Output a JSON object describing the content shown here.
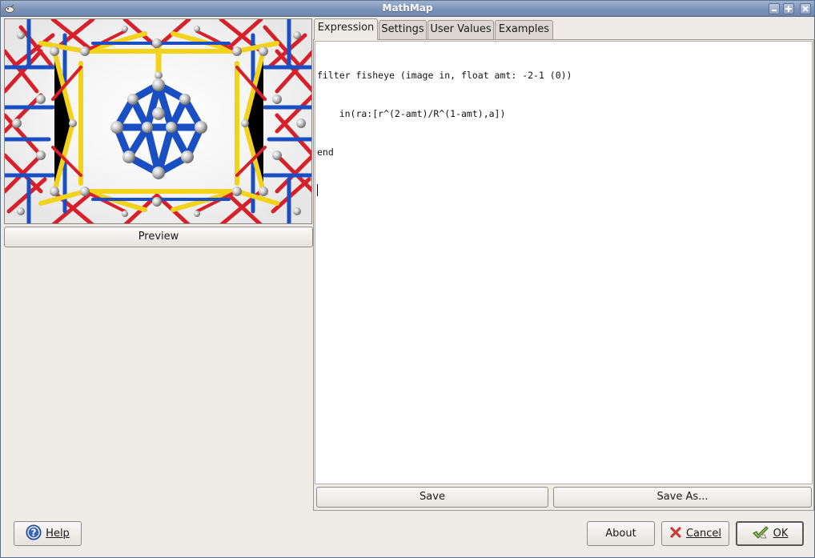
{
  "window": {
    "title": "MathMap"
  },
  "left": {
    "preview_button": "Preview"
  },
  "tabs": [
    {
      "label": "Expression",
      "active": true
    },
    {
      "label": "Settings",
      "active": false
    },
    {
      "label": "User Values",
      "active": false
    },
    {
      "label": "Examples",
      "active": false
    }
  ],
  "editor": {
    "lines": [
      "filter fisheye (image in, float amt: -2-1 (0))",
      "    in(ra:[r^(2-amt)/R^(1-amt),a])",
      "end"
    ]
  },
  "editor_buttons": {
    "save": "Save",
    "save_as": "Save As..."
  },
  "footer": {
    "help": "Help",
    "about": "About",
    "cancel": "Cancel",
    "ok": "OK"
  },
  "colors": {
    "titlebar": "#7c93b8",
    "window_bg": "#efebe7",
    "editor_bg": "#ffffff"
  },
  "icons": {
    "help": "help-question-icon",
    "cancel": "cancel-x-icon",
    "ok": "ok-check-icon"
  }
}
